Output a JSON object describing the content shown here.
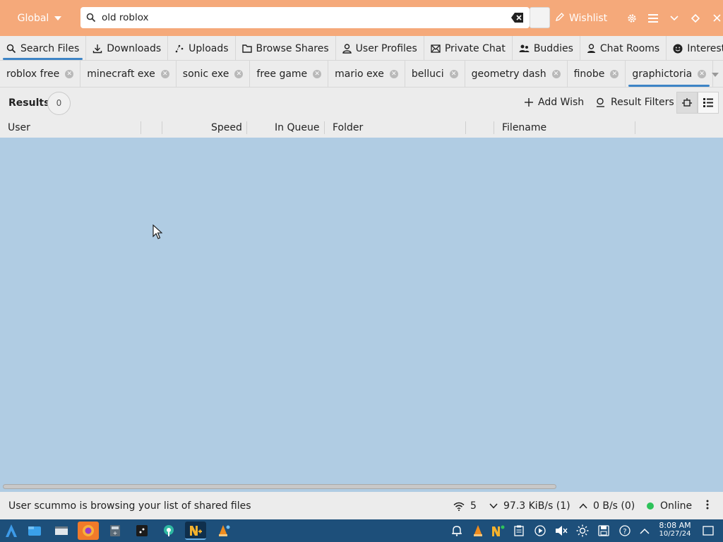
{
  "header": {
    "scope_label": "Global",
    "search_value": "old roblox",
    "wishlist_label": "Wishlist",
    "bg_color": "#f5a97a"
  },
  "main_tabs": [
    {
      "label": "Search Files",
      "icon": "search-icon",
      "active": true
    },
    {
      "label": "Downloads",
      "icon": "download-icon"
    },
    {
      "label": "Uploads",
      "icon": "upload-icon"
    },
    {
      "label": "Browse Shares",
      "icon": "folder-icon"
    },
    {
      "label": "User Profiles",
      "icon": "user-icon"
    },
    {
      "label": "Private Chat",
      "icon": "mail-icon"
    },
    {
      "label": "Buddies",
      "icon": "buddies-icon"
    },
    {
      "label": "Chat Rooms",
      "icon": "chat-rooms-icon"
    },
    {
      "label": "Interests",
      "icon": "smile-icon"
    }
  ],
  "search_tabs": [
    {
      "label": "roblox free"
    },
    {
      "label": "minecraft exe"
    },
    {
      "label": "sonic exe"
    },
    {
      "label": "free game"
    },
    {
      "label": "mario exe"
    },
    {
      "label": "belluci"
    },
    {
      "label": "geometry dash"
    },
    {
      "label": "finobe"
    },
    {
      "label": "graphictoria",
      "active": true
    }
  ],
  "results": {
    "label": "Results",
    "count": "0",
    "add_wish_label": "Add Wish",
    "filters_label": "Result Filters"
  },
  "columns": {
    "user": "User",
    "speed": "Speed",
    "in_queue": "In Queue",
    "folder": "Folder",
    "filename": "Filename"
  },
  "results_bg_color": "#b0cce3",
  "status": {
    "message": "User scummo is browsing your list of shared files",
    "connections": "5",
    "download_speed": "97.3 KiB/s (1)",
    "upload_speed": "0 B/s (0)",
    "online_label": "Online",
    "online_color": "#2ec25a"
  },
  "taskbar": {
    "time": "8:08 AM",
    "date": "10/27/24",
    "bg_color": "#1d4f7a"
  }
}
